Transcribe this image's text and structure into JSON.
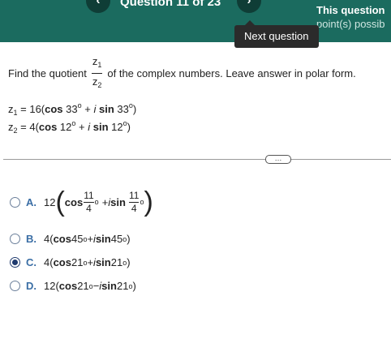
{
  "header": {
    "prev_label": "‹",
    "next_label": "›",
    "question_title": "Question 11 of 23",
    "points_line1": "This question",
    "points_line2": "point(s) possib",
    "tooltip": "Next question"
  },
  "problem": {
    "prompt_before": "Find the quotient",
    "z1": "z",
    "z1_sub": "1",
    "z2": "z",
    "z2_sub": "2",
    "prompt_after": "of the complex numbers. Leave answer in polar form.",
    "given1_lhs": "z",
    "given1_sub": "1",
    "given1_rhs": "= 16(",
    "given1_cos": "cos",
    "given1_angle1": " 33",
    "given1_deg": "o",
    "given1_plus": " + ",
    "given1_i": "i",
    "given1_sin": " sin",
    "given1_angle2": " 33",
    "given1_deg2": "o",
    "given1_close": ")",
    "given2_lhs": "z",
    "given2_sub": "2",
    "given2_rhs": "= 4(",
    "given2_cos": "cos",
    "given2_angle1": " 12",
    "given2_deg": "o",
    "given2_plus": " + ",
    "given2_i": "i",
    "given2_sin": " sin",
    "given2_angle2": " 12",
    "given2_deg2": "o",
    "given2_close": ")"
  },
  "more_button": "…",
  "choices": {
    "a": {
      "letter": "A.",
      "coef": "12",
      "cos": "cos",
      "num1": "11",
      "den1": "4",
      "deg": "o",
      "plus": "+ ",
      "i": "i",
      "sin": " sin",
      "num2": "11",
      "den2": "4",
      "deg2": "o",
      "checked": false
    },
    "b": {
      "letter": "B.",
      "text_pre": "4(",
      "cos": "cos",
      "angle1": " 45",
      "deg": "o",
      "plus": " + ",
      "i": "i",
      "sin": " sin",
      "angle2": " 45",
      "deg2": "o",
      "close": ")",
      "checked": false
    },
    "c": {
      "letter": "C.",
      "text_pre": "4(",
      "cos": "cos",
      "angle1": " 21",
      "deg": "o",
      "plus": " + ",
      "i": "i",
      "sin": " sin",
      "angle2": " 21",
      "deg2": "o",
      "close": ")",
      "checked": true
    },
    "d": {
      "letter": "D.",
      "text_pre": "12(",
      "cos": "cos",
      "angle1": " 21",
      "deg": "o",
      "plus": " − ",
      "i": "i",
      "sin": "  sin",
      "angle2": " 21",
      "deg2": "o",
      "close": ")",
      "checked": false
    }
  }
}
